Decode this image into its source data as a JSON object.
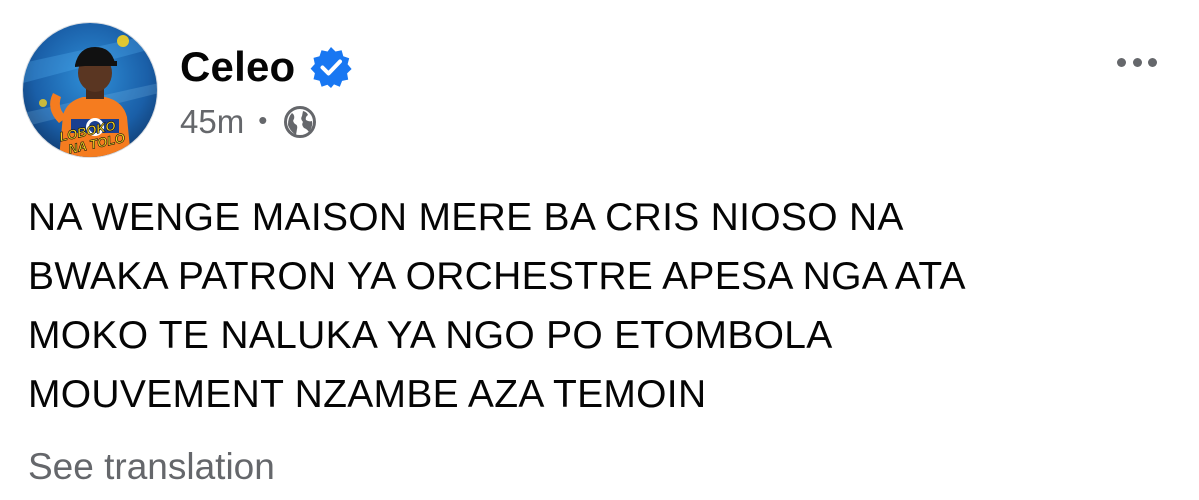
{
  "post": {
    "author": {
      "name": "Celeo",
      "verified": true,
      "avatar_text": [
        "LOBOKO",
        "NA TOLO"
      ]
    },
    "timestamp": "45m",
    "separator": "•",
    "audience_icon": "globe-icon",
    "more_icon": "ellipsis-icon",
    "text": "NA WENGE MAISON MERE BA CRIS NIOSO NA\nBWAKA PATRON YA ORCHESTRE APESA NGA ATA\nMOKO TE NALUKA YA NGO PO ETOMBOLA\nMOUVEMENT NZAMBE AZA TEMOIN",
    "see_translation": "See translation"
  },
  "colors": {
    "verified_blue": "#1877f2",
    "secondary_text": "#65676b",
    "primary_text": "#050505"
  }
}
